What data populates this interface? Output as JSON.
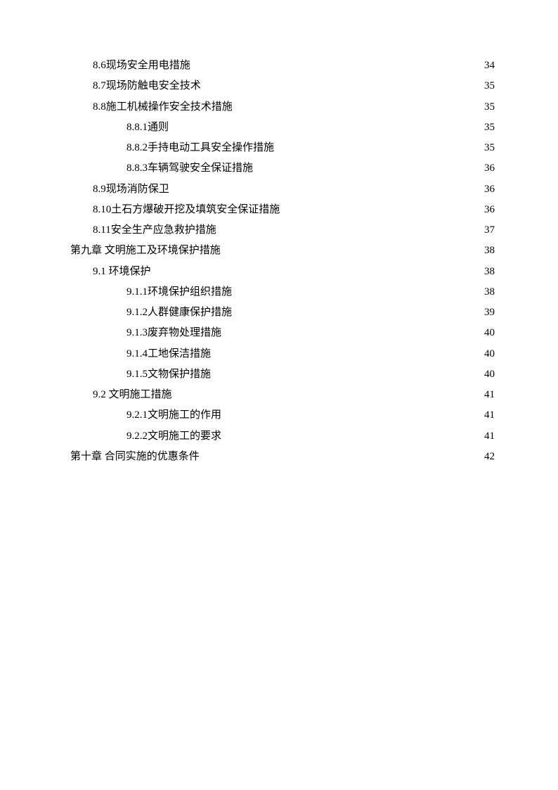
{
  "toc": [
    {
      "level": 1,
      "label": "8.6现场安全用电措施",
      "page": "34"
    },
    {
      "level": 1,
      "label": "8.7现场防触电安全技术",
      "page": "35"
    },
    {
      "level": 1,
      "label": "8.8施工机械操作安全技术措施",
      "page": "35"
    },
    {
      "level": 2,
      "label": "8.8.1通则",
      "page": "35"
    },
    {
      "level": 2,
      "label": "8.8.2手持电动工具安全操作措施",
      "page": "35"
    },
    {
      "level": 2,
      "label": "8.8.3车辆驾驶安全保证措施",
      "page": "36"
    },
    {
      "level": 1,
      "label": "8.9现场消防保卫",
      "page": "36"
    },
    {
      "level": 1,
      "label": "8.10土石方爆破开挖及填筑安全保证措施",
      "page": "36"
    },
    {
      "level": 1,
      "label": "8.11安全生产应急救护措施",
      "page": "37"
    },
    {
      "level": 0,
      "label": "第九章  文明施工及环境保护措施",
      "page": "38"
    },
    {
      "level": 1,
      "label": "9.1  环境保护",
      "page": "38"
    },
    {
      "level": 2,
      "label": "9.1.1环境保护组织措施",
      "page": "38"
    },
    {
      "level": 2,
      "label": "9.1.2人群健康保护措施",
      "page": "39"
    },
    {
      "level": 2,
      "label": "9.1.3废弃物处理措施",
      "page": "40"
    },
    {
      "level": 2,
      "label": "9.1.4工地保洁措施",
      "page": "40"
    },
    {
      "level": 2,
      "label": "9.1.5文物保护措施",
      "page": "40"
    },
    {
      "level": 1,
      "label": "9.2  文明施工措施",
      "page": "41"
    },
    {
      "level": 2,
      "label": "9.2.1文明施工的作用",
      "page": "41"
    },
    {
      "level": 2,
      "label": "9.2.2文明施工的要求",
      "page": "41"
    },
    {
      "level": 0,
      "label": "第十章  合同实施的优惠条件",
      "page": "42"
    }
  ]
}
